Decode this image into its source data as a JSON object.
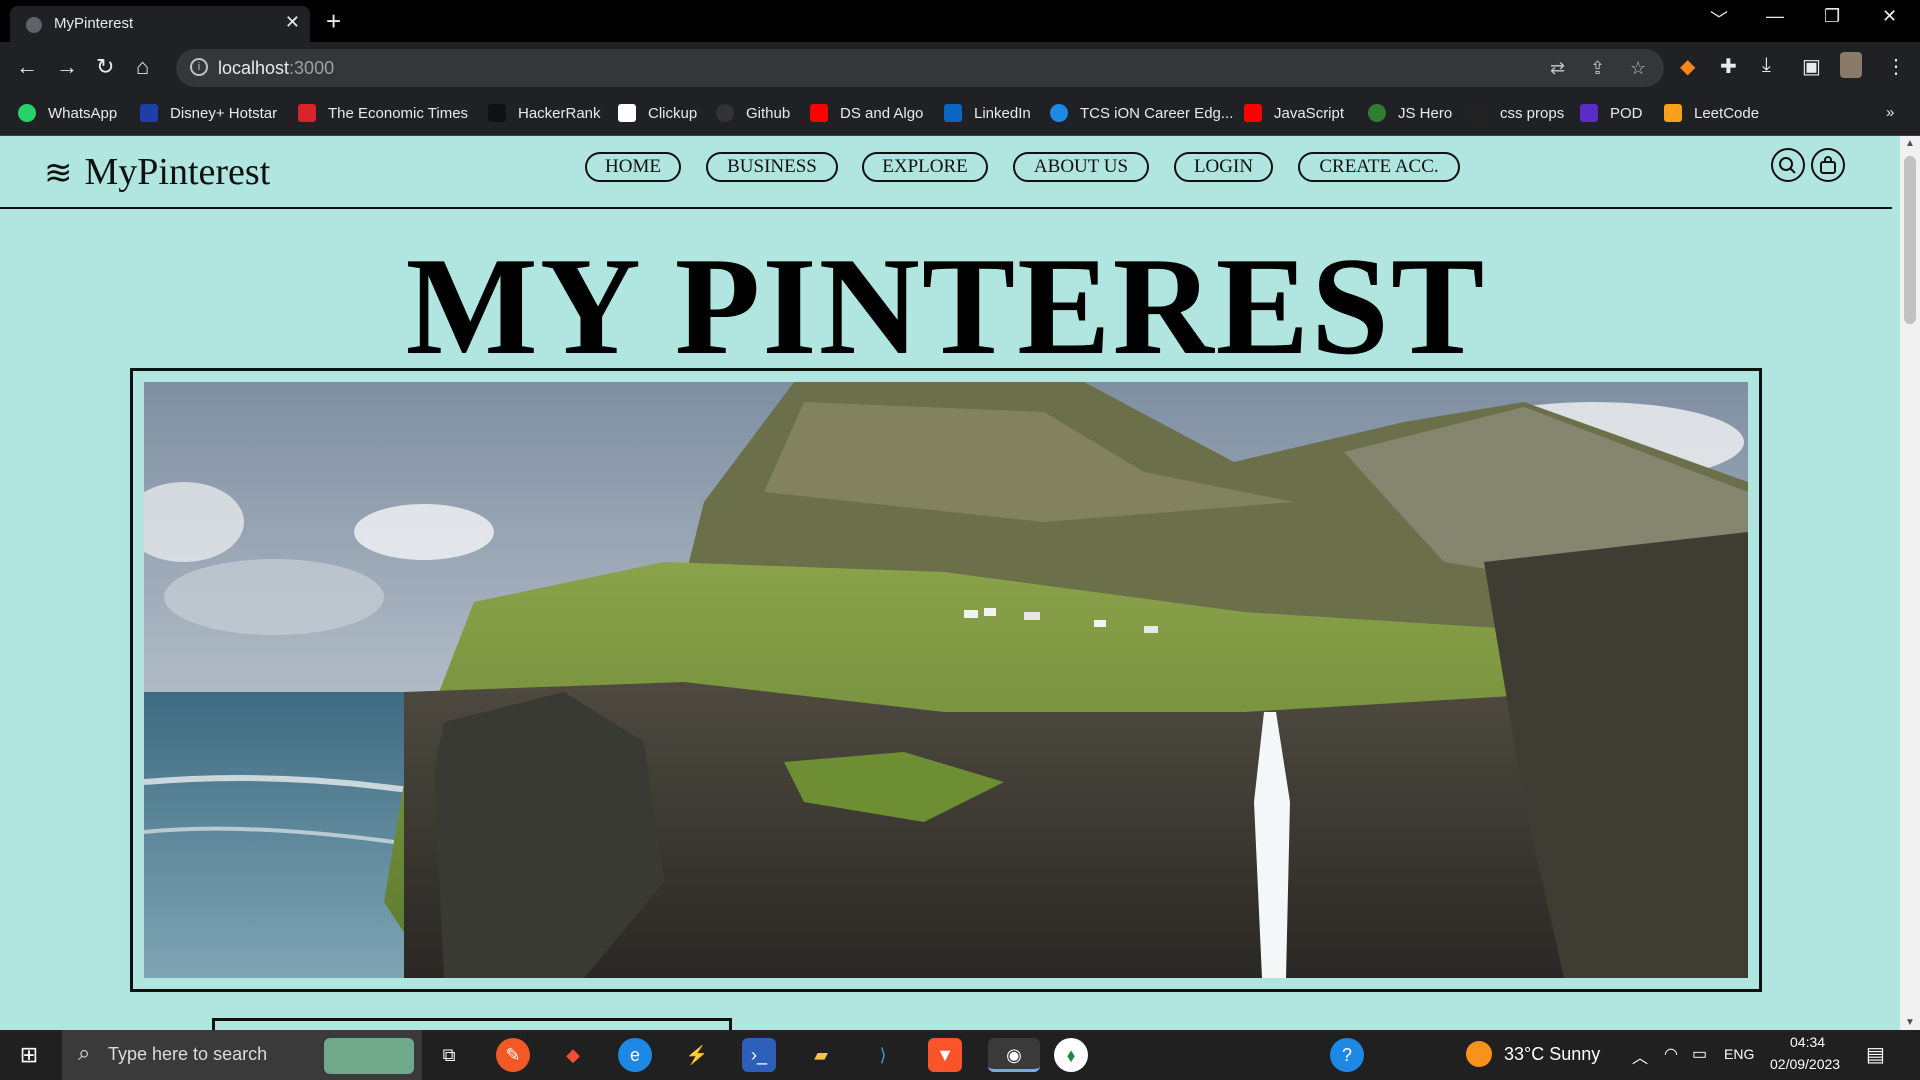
{
  "browser": {
    "tab_title": "MyPinterest",
    "tab_close": "✕",
    "new_tab": "+",
    "url_host": "localhost",
    "url_port": ":3000",
    "window_controls": [
      "﹀",
      "—",
      "❐",
      "✕"
    ],
    "bookmarks": [
      {
        "label": "WhatsApp",
        "color": "#25d366"
      },
      {
        "label": "Disney+ Hotstar",
        "color": "#1f3fa8"
      },
      {
        "label": "The Economic Times",
        "color": "#d8232a"
      },
      {
        "label": "HackerRank",
        "color": "#111111"
      },
      {
        "label": "Clickup",
        "color": "#7b68ee"
      },
      {
        "label": "Github",
        "color": "#333333"
      },
      {
        "label": "DS and Algo",
        "color": "#ff0000"
      },
      {
        "label": "LinkedIn",
        "color": "#0a66c2"
      },
      {
        "label": "TCS iON Career Edg...",
        "color": "#1e88e5"
      },
      {
        "label": "JavaScript",
        "color": "#ff0000"
      },
      {
        "label": "JS Hero",
        "color": "#2e7d32"
      },
      {
        "label": "css props",
        "color": "#222222"
      },
      {
        "label": "POD",
        "color": "#5b2cc9"
      },
      {
        "label": "LeetCode",
        "color": "#f89f1b"
      }
    ],
    "bookmarks_more": "»"
  },
  "site": {
    "logo_text": "MyPinterest",
    "nav": [
      "HOME",
      "BUSINESS",
      "EXPLORE",
      "ABOUT US",
      "LOGIN",
      "CREATE ACC."
    ],
    "hero_title": "MY PINTEREST",
    "bg_color": "#b0e6df"
  },
  "taskbar": {
    "search_placeholder": "Type here to search",
    "weather": "33°C  Sunny",
    "language": "ENG",
    "time": "04:34",
    "date": "02/09/2023"
  }
}
